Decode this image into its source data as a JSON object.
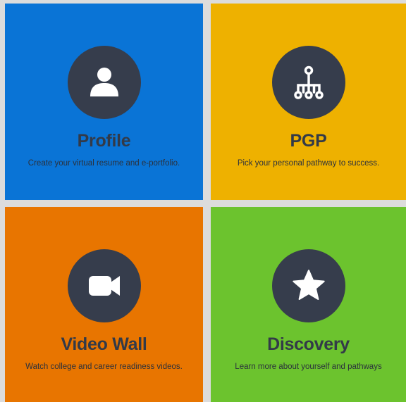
{
  "colors": {
    "gap": "#dcdcdc",
    "circle": "#363d4c",
    "icon": "#ffffff",
    "text": "#333a48"
  },
  "tiles": [
    {
      "title": "Profile",
      "description": "Create your virtual resume and e-portfolio.",
      "color": "#0a74d6",
      "icon": "user-icon"
    },
    {
      "title": "PGP",
      "description": "Pick your personal pathway to success.",
      "color": "#eeb100",
      "icon": "pathway-tree-icon"
    },
    {
      "title": "Video Wall",
      "description": "Watch college and career readiness videos.",
      "color": "#e87500",
      "icon": "video-camera-icon"
    },
    {
      "title": "Discovery",
      "description": "Learn more about yourself and pathways",
      "color": "#6cc32e",
      "icon": "star-icon"
    }
  ]
}
